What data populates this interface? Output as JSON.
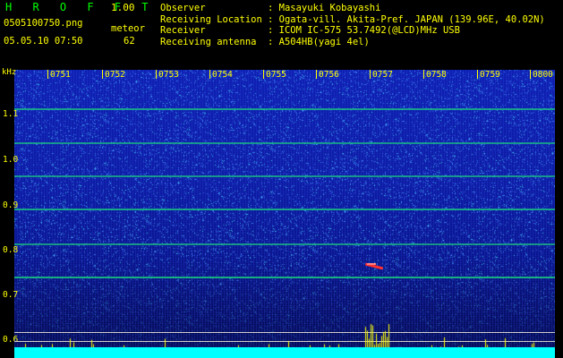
{
  "header": {
    "title": "H R O F F T",
    "version": "1.00",
    "filename": "0505100750.png",
    "datetime": "05.05.10 07:50",
    "meteor_label": "meteor",
    "meteor_count": "62",
    "observer_key": "Observer",
    "observer_val": ": Masayuki Kobayashi",
    "location_key": "Receiving Location",
    "location_val": ": Ogata-vill. Akita-Pref. JAPAN (139.96E, 40.02N)",
    "receiver_key": "Receiver",
    "receiver_val": ": ICOM IC-575 53.7492(@LCD)MHz USB",
    "antenna_key": "Receiving antenna",
    "antenna_val": ": A504HB(yagi 4el)"
  },
  "axis": {
    "unit": "kHz",
    "y_ticks": [
      "1.1",
      "1.0",
      "0.9",
      "0.8",
      "0.7",
      "0.6"
    ],
    "x_ticks": [
      "0751",
      "0752",
      "0753",
      "0754",
      "0755",
      "0756",
      "0757",
      "0758",
      "0759",
      "0800"
    ]
  },
  "colors": {
    "label": "#ffff00",
    "title": "#00ff00",
    "carrier": "#20d080",
    "floor": "#00ffff"
  }
}
